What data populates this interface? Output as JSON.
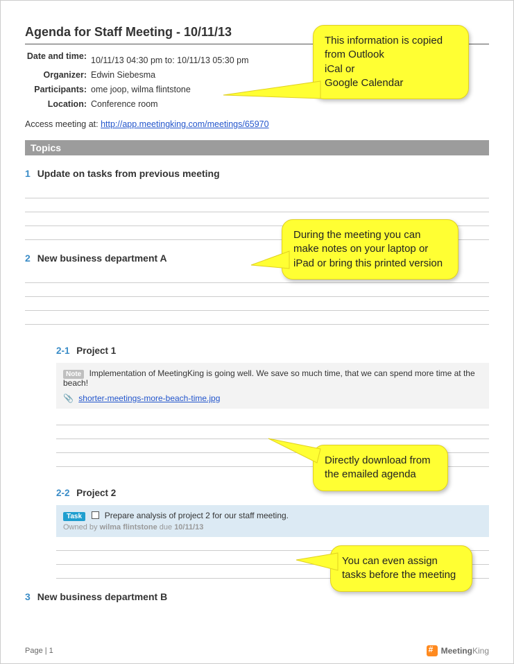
{
  "title": "Agenda for Staff Meeting - 10/11/13",
  "meta": {
    "date_label": "Date and time:",
    "date_value": "10/11/13 04:30 pm to: 10/11/13 05:30 pm",
    "org_label": "Organizer:",
    "org_value": "Edwin Siebesma",
    "part_label": "Participants:",
    "part_value": "ome joop, wilma flintstone",
    "loc_label": "Location:",
    "loc_value": "Conference room"
  },
  "access": {
    "prefix": "Access meeting at: ",
    "url": "http://app.meetingking.com/meetings/65970"
  },
  "topics_header": "Topics",
  "topics": {
    "t1_num": "1",
    "t1_title": "Update on tasks from previous meeting",
    "t2_num": "2",
    "t2_title": "New business department A",
    "s21_num": "2-1",
    "s21_title": "Project 1",
    "note_badge": "Note",
    "note_text": "Implementation of MeetingKing is going well. We save so much time, that we can spend more time at the beach!",
    "attachment": "shorter-meetings-more-beach-time.jpg",
    "s22_num": "2-2",
    "s22_title": "Project 2",
    "task_badge": "Task",
    "task_text": "Prepare analysis of project 2 for our staff meeting.",
    "task_owner_prefix": "Owned by ",
    "task_owner_name": "wilma flintstone",
    "task_due_prefix": "  due ",
    "task_due": "10/11/13",
    "t3_num": "3",
    "t3_title": "New business department B"
  },
  "footer": {
    "page": "Page | 1",
    "logo1": "Meeting",
    "logo2": "King"
  },
  "callouts": {
    "c1": "This information is copied from Outlook\niCal or\nGoogle Calendar",
    "c2": "During the meeting you can make notes on your laptop or iPad or bring this printed version",
    "c3": "Directly download from the emailed agenda",
    "c4": "You can even assign tasks before the meeting"
  }
}
